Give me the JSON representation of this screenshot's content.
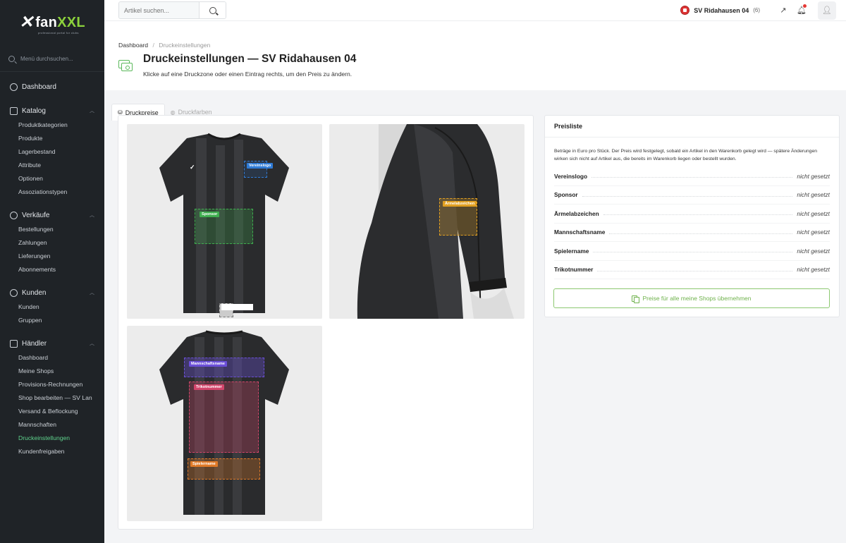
{
  "brand": {
    "name_prefix": "fan",
    "name_suffix": "XXL",
    "tagline": "professional portal for clubs"
  },
  "sidebar": {
    "search_placeholder": "Menü durchsuchen...",
    "dashboard": "Dashboard",
    "groups": [
      {
        "label": "Katalog",
        "items": [
          "Produktkategorien",
          "Produkte",
          "Lagerbestand",
          "Attribute",
          "Optionen",
          "Assoziationstypen"
        ]
      },
      {
        "label": "Verkäufe",
        "items": [
          "Bestellungen",
          "Zahlungen",
          "Lieferungen",
          "Abonnements"
        ]
      },
      {
        "label": "Kunden",
        "items": [
          "Kunden",
          "Gruppen"
        ]
      },
      {
        "label": "Händler",
        "items": [
          "Dashboard",
          "Meine Shops",
          "Provisions-Rechnungen",
          "Shop bearbeiten — SV Lan",
          "Versand & Beflockung",
          "Mannschaften",
          "Druckeinstellungen",
          "Kundenfreigaben"
        ]
      }
    ],
    "active_item": "Druckeinstellungen",
    "active_color": "#5fd38d"
  },
  "topbar": {
    "search_placeholder": "Artikel suchen...",
    "shop_name": "SV Ridahausen 04",
    "shop_count": "(6)"
  },
  "header": {
    "breadcrumb_home": "Dashboard",
    "breadcrumb_current": "Druckeinstellungen",
    "title": "Druckeinstellungen — SV Ridahausen 04",
    "subtitle": "Klicke auf eine Druckzone oder einen Eintrag rechts, um den Preis zu ändern."
  },
  "tabs": [
    {
      "label": "Druckpreise",
      "active": true
    },
    {
      "label": "Druckfarben",
      "active": false
    }
  ],
  "zones": [
    {
      "label": "Vereinslogo",
      "color": "#2f7bd6"
    },
    {
      "label": "Sponsor",
      "color": "#3fae4f"
    },
    {
      "label": "Ärmelabzeichen",
      "color": "#e2a021"
    },
    {
      "label": "Mannschaftsname",
      "color": "#6b4fd8"
    },
    {
      "label": "Trikotnummer",
      "color": "#d2456b"
    },
    {
      "label": "Spielername",
      "color": "#e07a28"
    }
  ],
  "price_panel": {
    "title": "Preisliste",
    "description": "Beträge in Euro pro Stück. Der Preis wird festgelegt, sobald ein Artikel in den Warenkorb gelegt wird — spätere Änderungen wirken sich nicht auf Artikel aus, die bereits im Warenkorb liegen oder bestellt wurden.",
    "rows": [
      {
        "name": "Vereinslogo",
        "value": "nicht gesetzt"
      },
      {
        "name": "Sponsor",
        "value": "nicht gesetzt"
      },
      {
        "name": "Ärmelabzeichen",
        "value": "nicht gesetzt"
      },
      {
        "name": "Mannschaftsname",
        "value": "nicht gesetzt"
      },
      {
        "name": "Spielername",
        "value": "nicht gesetzt"
      },
      {
        "name": "Trikotnummer",
        "value": "nicht gesetzt"
      }
    ],
    "apply_button": "Preise für alle meine Shops übernehmen"
  }
}
